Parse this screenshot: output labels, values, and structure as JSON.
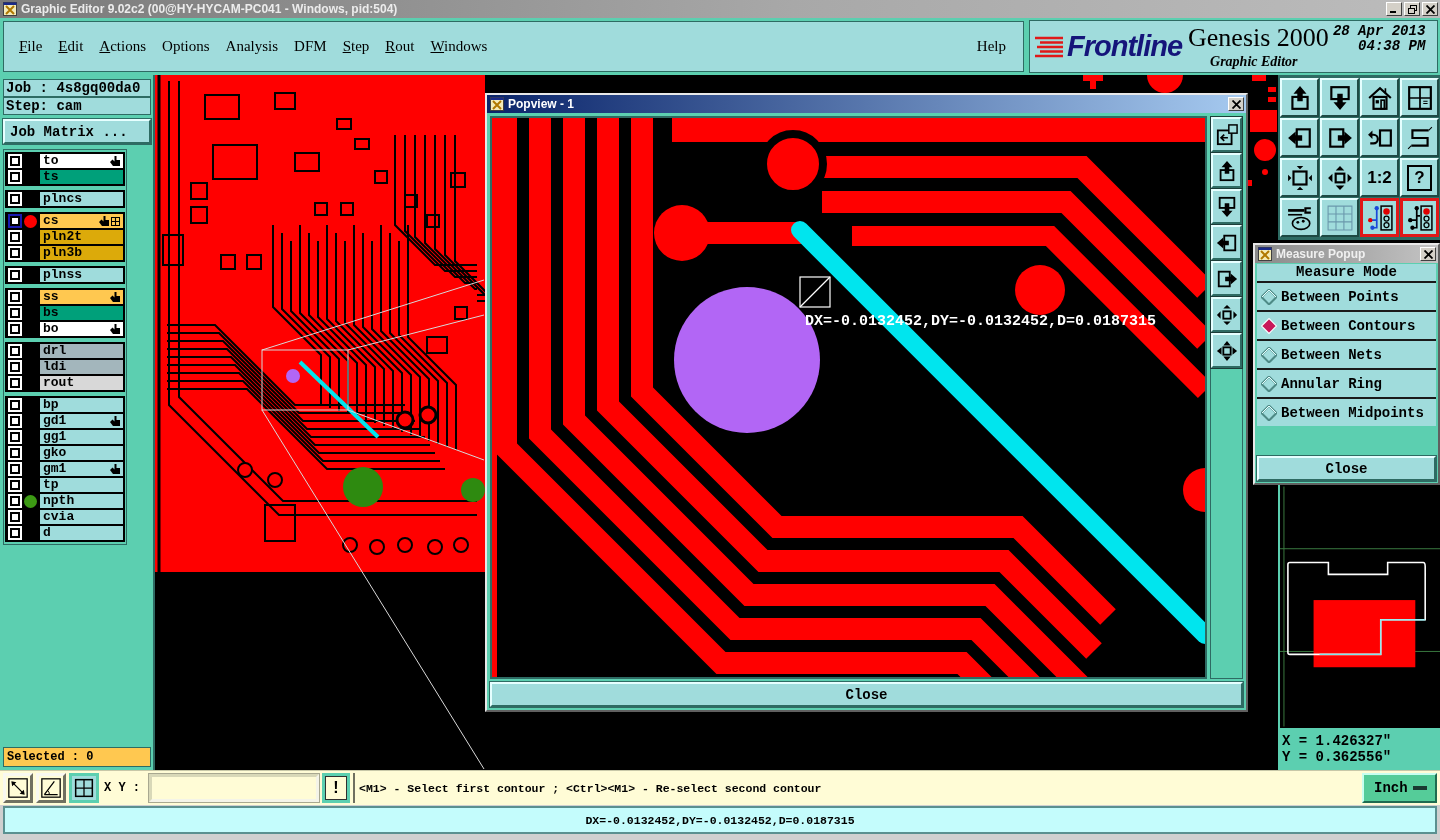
{
  "window": {
    "title": "Graphic Editor 9.02c2 (00@HY-HYCAM-PC041 - Windows, pid:504)"
  },
  "menu": [
    {
      "label": "File",
      "mnemonic": true
    },
    {
      "label": "Edit",
      "mnemonic": true
    },
    {
      "label": "Actions",
      "mnemonic": true
    },
    {
      "label": "Options",
      "mnemonic": false
    },
    {
      "label": "Analysis",
      "mnemonic": false
    },
    {
      "label": "DFM",
      "mnemonic": false
    },
    {
      "label": "Step",
      "mnemonic": true
    },
    {
      "label": "Rout",
      "mnemonic": true
    },
    {
      "label": "Windows",
      "mnemonic": true
    },
    {
      "label": "Help",
      "mnemonic": false
    }
  ],
  "branding": {
    "logo": "Frontline",
    "product": "Genesis 2000",
    "subtitle": "Graphic Editor",
    "date": "28 Apr 2013",
    "time": "04:38 PM"
  },
  "job_panel": {
    "job": "Job : 4s8gq00da0",
    "step": "Step: cam",
    "matrix_button": "Job Matrix ...",
    "layer_groups": [
      {
        "layers": [
          {
            "name": "to",
            "color": "#ffffff",
            "checked": false,
            "selected": false,
            "hand_mark": true,
            "grid_mark": false
          },
          {
            "name": "ts",
            "color": "#00a07a",
            "checked": false,
            "selected": false,
            "hand_mark": false,
            "grid_mark": false
          }
        ]
      },
      {
        "layers": [
          {
            "name": "plncs",
            "color": "#9fdcdc",
            "checked": false,
            "selected": false,
            "hand_mark": false,
            "grid_mark": false
          }
        ]
      },
      {
        "layers": [
          {
            "name": "cs",
            "color": "#ffc850",
            "checked": false,
            "selected": true,
            "hand_mark": true,
            "grid_mark": true,
            "dot": {
              "color": "#ff0000"
            }
          },
          {
            "name": "pln2t",
            "color": "#dcaa0a",
            "checked": false,
            "selected": false,
            "hand_mark": false,
            "grid_mark": false
          },
          {
            "name": "pln3b",
            "color": "#dcaa0a",
            "checked": false,
            "selected": false,
            "hand_mark": false,
            "grid_mark": false
          }
        ]
      },
      {
        "layers": [
          {
            "name": "plnss",
            "color": "#9fdcdc",
            "checked": false,
            "selected": false,
            "hand_mark": false,
            "grid_mark": false
          }
        ]
      },
      {
        "layers": [
          {
            "name": "ss",
            "color": "#ffc850",
            "checked": false,
            "selected": false,
            "hand_mark": true,
            "grid_mark": false
          },
          {
            "name": "bs",
            "color": "#00a07a",
            "checked": false,
            "selected": false,
            "hand_mark": false,
            "grid_mark": false
          },
          {
            "name": "bo",
            "color": "#ffffff",
            "checked": false,
            "selected": false,
            "hand_mark": true,
            "grid_mark": false
          }
        ]
      },
      {
        "layers": [
          {
            "name": "drl",
            "color": "#a3b6bc",
            "checked": false,
            "selected": false,
            "hand_mark": false,
            "grid_mark": false
          },
          {
            "name": "ldi",
            "color": "#a3b6bc",
            "checked": false,
            "selected": false,
            "hand_mark": false,
            "grid_mark": false
          },
          {
            "name": "rout",
            "color": "#d8d8d8",
            "checked": false,
            "selected": false,
            "hand_mark": false,
            "grid_mark": false
          }
        ]
      },
      {
        "layers": [
          {
            "name": "bp",
            "color": "#9fdcdc",
            "checked": false,
            "selected": false,
            "hand_mark": false,
            "grid_mark": false
          },
          {
            "name": "gd1",
            "color": "#9fdcdc",
            "checked": false,
            "selected": false,
            "hand_mark": true,
            "grid_mark": false
          },
          {
            "name": "gg1",
            "color": "#9fdcdc",
            "checked": false,
            "selected": false,
            "hand_mark": false,
            "grid_mark": false
          },
          {
            "name": "gko",
            "color": "#9fdcdc",
            "checked": false,
            "selected": false,
            "hand_mark": false,
            "grid_mark": false
          },
          {
            "name": "gm1",
            "color": "#9fdcdc",
            "checked": false,
            "selected": false,
            "hand_mark": true,
            "grid_mark": false
          },
          {
            "name": "tp",
            "color": "#9fdcdc",
            "checked": false,
            "selected": false,
            "hand_mark": false,
            "grid_mark": false
          },
          {
            "name": "npth",
            "color": "#9fdcdc",
            "checked": false,
            "selected": false,
            "hand_mark": false,
            "grid_mark": false,
            "dot": {
              "color": "#3c9a14"
            }
          },
          {
            "name": "cvia",
            "color": "#9fdcdc",
            "checked": false,
            "selected": false,
            "hand_mark": false,
            "grid_mark": false
          },
          {
            "name": "d",
            "color": "#9fdcdc",
            "checked": false,
            "selected": false,
            "hand_mark": false,
            "grid_mark": false
          }
        ]
      }
    ],
    "selected_count": "Selected : 0"
  },
  "toolbar": [
    {
      "kind": "icon",
      "selected": false
    },
    {
      "kind": "icon",
      "selected": false
    },
    {
      "kind": "icon",
      "selected": false
    },
    {
      "kind": "icon",
      "selected": false
    },
    {
      "kind": "icon",
      "selected": false
    },
    {
      "kind": "icon",
      "selected": false
    },
    {
      "kind": "icon",
      "selected": false
    },
    {
      "kind": "icon",
      "selected": false
    },
    {
      "kind": "icon",
      "selected": false
    },
    {
      "kind": "icon",
      "selected": false
    },
    {
      "kind": "text",
      "label": "1:2",
      "selected": false
    },
    {
      "kind": "boxed_text",
      "label": "?",
      "selected": false
    },
    {
      "kind": "icon",
      "selected": false
    },
    {
      "kind": "icon",
      "selected": false
    },
    {
      "kind": "icon",
      "selected": true
    },
    {
      "kind": "icon",
      "selected": true
    }
  ],
  "popview": {
    "title": "Popview - 1",
    "measurement": "DX=-0.0132452,DY=-0.0132452,D=0.0187315",
    "close_button": "Close"
  },
  "measure_popup": {
    "title": "Measure Popup",
    "heading": "Measure Mode",
    "modes": [
      {
        "label": "Between Points",
        "selected": false
      },
      {
        "label": "Between Contours",
        "selected": true
      },
      {
        "label": "Between Nets",
        "selected": false
      },
      {
        "label": "Annular Ring",
        "selected": false
      },
      {
        "label": "Between Midpoints",
        "selected": false
      }
    ],
    "close_button": "Close"
  },
  "coordinates": {
    "x": "X = 1.426327\"",
    "y": "Y = 0.362556\""
  },
  "command_bar": {
    "tools": [
      {
        "selected": false
      },
      {
        "selected": false
      },
      {
        "selected": true
      }
    ],
    "xy_label": "X Y :",
    "message_button": "!",
    "message": "<M1> - Select first contour ; <Ctrl><M1> - Re-select second contour",
    "units": "Inch"
  },
  "status_bar": {
    "readout": "DX=-0.0132452,DY=-0.0132452,D=0.0187315"
  }
}
